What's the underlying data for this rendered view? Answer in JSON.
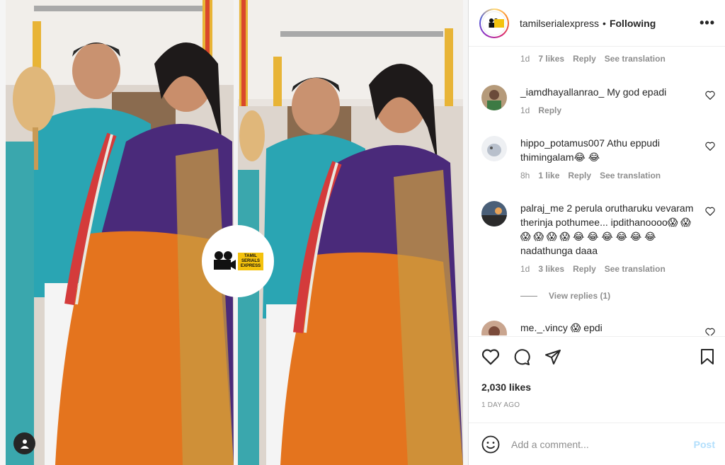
{
  "post": {
    "username": "tamilserialexpress",
    "follow_status": "Following",
    "watermark_text": "TAMIL SERIALS EXPRESS",
    "likes": "2,030 likes",
    "date": "1 DAY AGO"
  },
  "comments": [
    {
      "user": "",
      "text": "",
      "time": "1d",
      "likes": "7 likes",
      "reply": "Reply",
      "translation": "See translation"
    },
    {
      "user": "_iamdhayallanrao_",
      "text": "My god epadi",
      "time": "1d",
      "reply": "Reply"
    },
    {
      "user": "hippo_potamus007",
      "text": "Athu eppudi thimingalam😂 😂",
      "time": "8h",
      "likes": "1 like",
      "reply": "Reply",
      "translation": "See translation"
    },
    {
      "user": "palraj_me",
      "text": "2 perula orutharuku vevaram therinja pothumee... ipdithanoooo😱 😱 😱 😱 😱 😱 😂 😂 😂 😂 😂 😂 nadathunga daaa",
      "time": "1d",
      "likes": "3 likes",
      "reply": "Reply",
      "translation": "See translation"
    },
    {
      "user": "me._.vincy",
      "text": "😱 epdi"
    }
  ],
  "view_replies": "View replies (1)",
  "add_comment": {
    "placeholder": "Add a comment...",
    "post_label": "Post"
  },
  "colors": {
    "link_blue": "#b2dffc",
    "meta_grey": "#8e8e8e",
    "text": "#262626"
  }
}
